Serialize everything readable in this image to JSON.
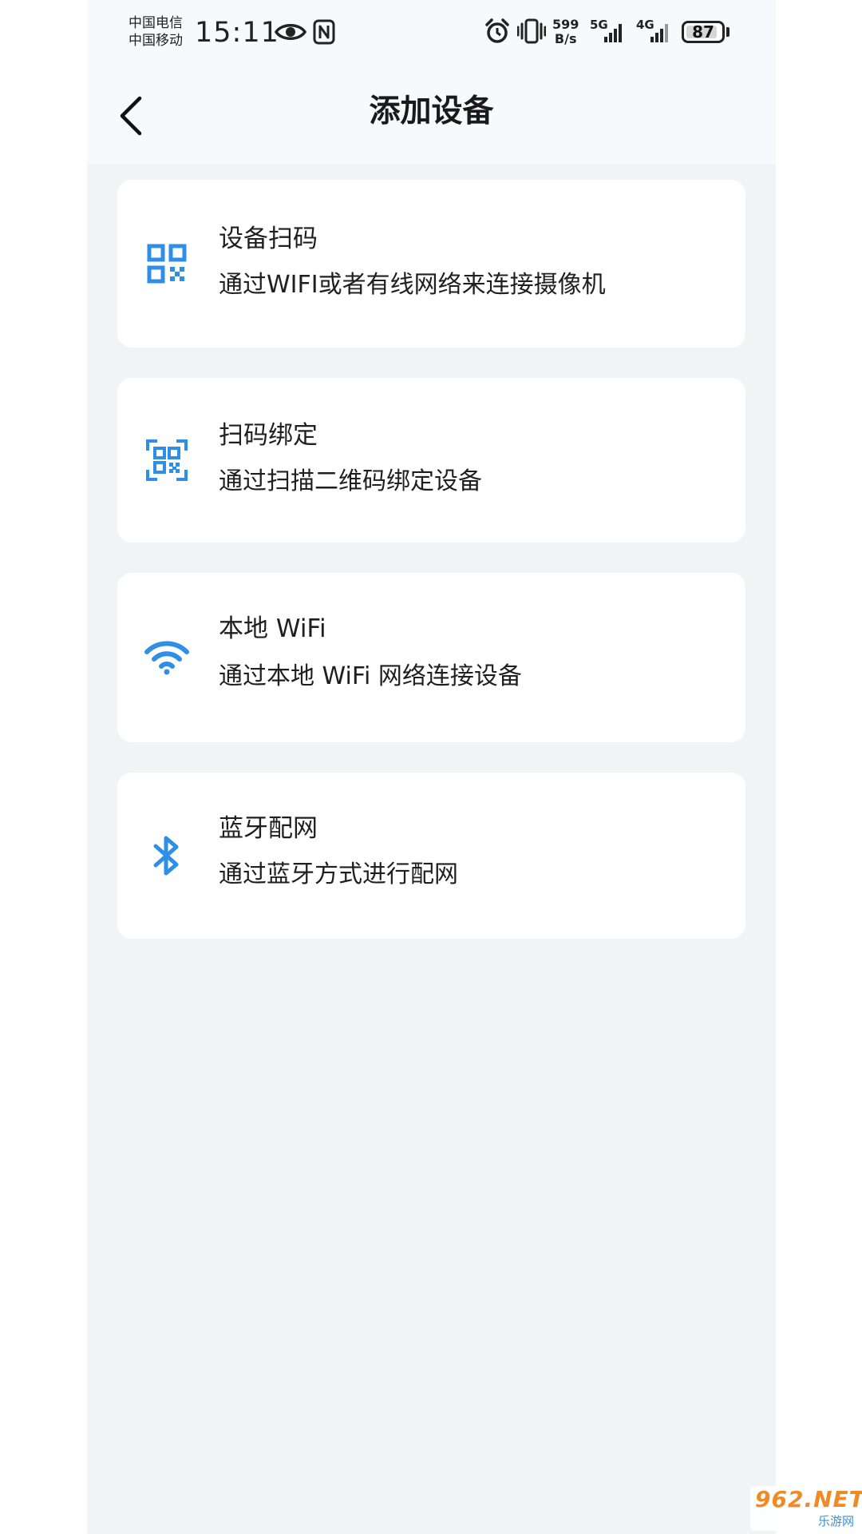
{
  "status_bar": {
    "carrier_1": "中国电信",
    "carrier_2": "中国移动",
    "time": "15:11",
    "net_speed_value": "599",
    "net_speed_unit": "B/s",
    "signal_1_label": "5G",
    "signal_2_label": "4G",
    "battery_level": "87",
    "icons": [
      "eye-icon",
      "nfc-icon",
      "alarm-icon",
      "vibrate-icon",
      "signal-icon",
      "battery-icon"
    ]
  },
  "header": {
    "title": "添加设备",
    "back_icon": "chevron-left-icon"
  },
  "options": [
    {
      "title": "设备扫码",
      "description": "通过WIFI或者有线网络来连接摄像机",
      "icon": "qr-code-icon"
    },
    {
      "title": "扫码绑定",
      "description": "通过扫描二维码绑定设备",
      "icon": "qr-scan-icon"
    },
    {
      "title": "本地 WiFi",
      "description": "通过本地 WiFi 网络连接设备",
      "icon": "wifi-icon"
    },
    {
      "title": "蓝牙配网",
      "description": "通过蓝牙方式进行配网",
      "icon": "bluetooth-icon"
    }
  ],
  "watermark": {
    "top": "962.NET",
    "bottom": "乐游网"
  },
  "colors": {
    "accent": "#2f8fe6",
    "page_background": "#f2f3f5",
    "header_background": "#f7f9fc",
    "card_background": "#ffffff",
    "text": "#1f1f1f"
  }
}
